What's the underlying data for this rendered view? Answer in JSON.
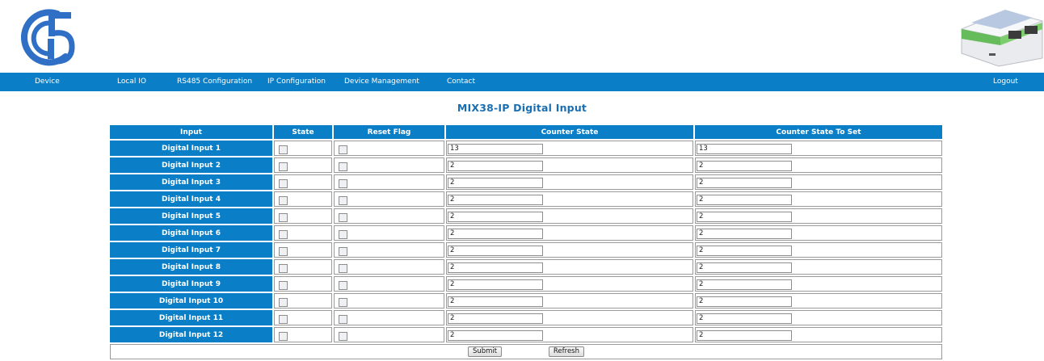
{
  "header": {
    "logo_icon": "g5-logo-icon",
    "device_image": "device-photo"
  },
  "nav": {
    "items": [
      {
        "label": "Device"
      },
      {
        "label": "Local IO"
      },
      {
        "label": "RS485 Configuration"
      },
      {
        "label": "IP Configuration"
      },
      {
        "label": "Device Management"
      },
      {
        "label": "Contact"
      }
    ],
    "logout": "Logout"
  },
  "page": {
    "title": "MIX38-IP Digital Input"
  },
  "table": {
    "headers": [
      "Input",
      "State",
      "Reset Flag",
      "Counter State",
      "Counter State To Set"
    ],
    "rows": [
      {
        "label": "Digital Input 1",
        "counter": "13",
        "counter_set": "13"
      },
      {
        "label": "Digital Input 2",
        "counter": "2",
        "counter_set": "2"
      },
      {
        "label": "Digital Input 3",
        "counter": "2",
        "counter_set": "2"
      },
      {
        "label": "Digital Input 4",
        "counter": "2",
        "counter_set": "2"
      },
      {
        "label": "Digital Input 5",
        "counter": "2",
        "counter_set": "2"
      },
      {
        "label": "Digital Input 6",
        "counter": "2",
        "counter_set": "2"
      },
      {
        "label": "Digital Input 7",
        "counter": "2",
        "counter_set": "2"
      },
      {
        "label": "Digital Input 8",
        "counter": "2",
        "counter_set": "2"
      },
      {
        "label": "Digital Input 9",
        "counter": "2",
        "counter_set": "2"
      },
      {
        "label": "Digital Input 10",
        "counter": "2",
        "counter_set": "2"
      },
      {
        "label": "Digital Input 11",
        "counter": "2",
        "counter_set": "2"
      },
      {
        "label": "Digital Input 12",
        "counter": "2",
        "counter_set": "2"
      }
    ]
  },
  "buttons": {
    "submit": "Submit",
    "refresh": "Refresh"
  },
  "colors": {
    "accent": "#0a7fc8",
    "title": "#1a6fb3"
  }
}
